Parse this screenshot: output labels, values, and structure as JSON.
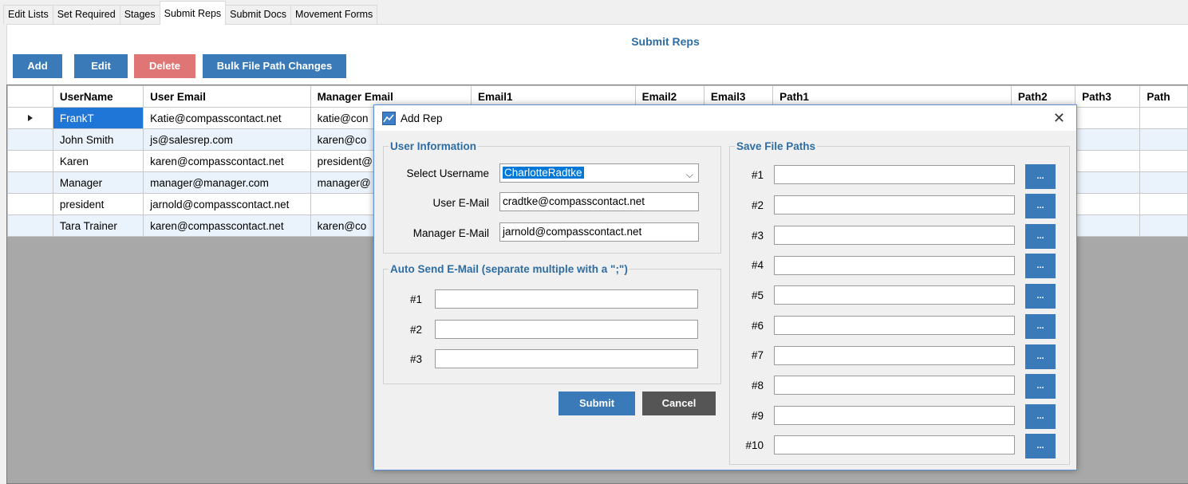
{
  "tabs": [
    "Edit Lists",
    "Set Required",
    "Stages",
    "Submit Reps",
    "Submit Docs",
    "Movement Forms"
  ],
  "active_tab": "Submit Reps",
  "page_title": "Submit Reps",
  "toolbar": {
    "add": "Add",
    "edit": "Edit",
    "delete": "Delete",
    "bulk": "Bulk File Path Changes"
  },
  "grid": {
    "columns": [
      "UserName",
      "User Email",
      "Manager Email",
      "Email1",
      "Email2",
      "Email3",
      "Path1",
      "Path2",
      "Path3",
      "Path"
    ],
    "rows": [
      {
        "username": "FrankT",
        "user_email": "Katie@compasscontact.net",
        "manager_email": "katie@con"
      },
      {
        "username": "John Smith",
        "user_email": "js@salesrep.com",
        "manager_email": "karen@co"
      },
      {
        "username": "Karen",
        "user_email": "karen@compasscontact.net",
        "manager_email": "president@"
      },
      {
        "username": "Manager",
        "user_email": "manager@manager.com",
        "manager_email": "manager@"
      },
      {
        "username": "president",
        "user_email": "jarnold@compasscontact.net",
        "manager_email": ""
      },
      {
        "username": "Tara Trainer",
        "user_email": "karen@compasscontact.net",
        "manager_email": "karen@co"
      }
    ]
  },
  "dialog": {
    "title": "Add Rep",
    "user_info_legend": "User Information",
    "select_username_label": "Select Username",
    "select_username_value": "CharlotteRadtke",
    "user_email_label": "User E-Mail",
    "user_email_value": "cradtke@compasscontact.net",
    "manager_email_label": "Manager E-Mail",
    "manager_email_value": "jarnold@compasscontact.net",
    "auto_send_legend": "Auto Send E-Mail (separate multiple with a \";\")",
    "auto_send_labels": [
      "#1",
      "#2",
      "#3"
    ],
    "save_paths_legend": "Save File Paths",
    "path_labels": [
      "#1",
      "#2",
      "#3",
      "#4",
      "#5",
      "#6",
      "#7",
      "#8",
      "#9",
      "#10"
    ],
    "browse_label": "...",
    "submit": "Submit",
    "cancel": "Cancel"
  }
}
